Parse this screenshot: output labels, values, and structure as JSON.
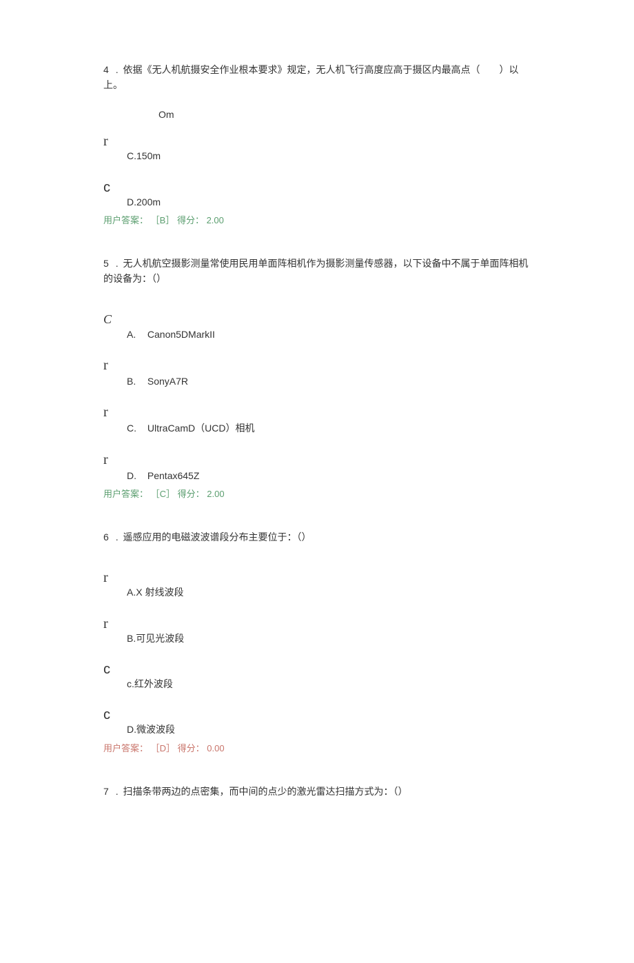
{
  "q4": {
    "number": "4",
    "gap": ".",
    "text": "依据《无人机航摄安全作业根本要求》规定，无人机飞行高度应高于摄区内最高点（　　）以上。",
    "optB_text": "Om",
    "markerB": "r",
    "optC_label": "C.150m",
    "markerC": "c",
    "optD_label": "D.200m",
    "answer_prefix": "用户答案：",
    "answer_letter": "［B］",
    "answer_score": "得分：",
    "answer_value": "2.00"
  },
  "q5": {
    "number": "5",
    "gap": ".",
    "text": "无人机航空摄影测量常使用民用单面阵相机作为摄影测量传感器，以下设备中不属于单面阵相机的设备为：（）",
    "markerA": "C",
    "optA_letter": "A.",
    "optA_text": "Canon5DMarkII",
    "markerB": "r",
    "optB_letter": "B.",
    "optB_text": "SonyA7R",
    "markerC": "r",
    "optC_letter": "C.",
    "optC_text": "UltraCamD（UCD）相机",
    "markerD": "r",
    "optD_letter": "D.",
    "optD_text": "Pentax645Z",
    "answer_prefix": "用户答案：",
    "answer_letter": "［C］",
    "answer_score": "得分：",
    "answer_value": "2.00"
  },
  "q6": {
    "number": "6",
    "gap": ".",
    "text": "遥感应用的电磁波波谱段分布主要位于：（）",
    "markerA": "r",
    "optA_label": "A.X 射线波段",
    "markerB": "r",
    "optB_label": "B.可见光波段",
    "markerC": "c",
    "optC_label": "c.红外波段",
    "markerD": "c",
    "optD_label": "D.微波波段",
    "answer_prefix": "用户答案：",
    "answer_letter": "［D］",
    "answer_score": "得分：",
    "answer_value": "0.00"
  },
  "q7": {
    "number": "7",
    "gap": ".",
    "text": "扫描条带两边的点密集，而中间的点少的激光雷达扫描方式为：（）"
  }
}
